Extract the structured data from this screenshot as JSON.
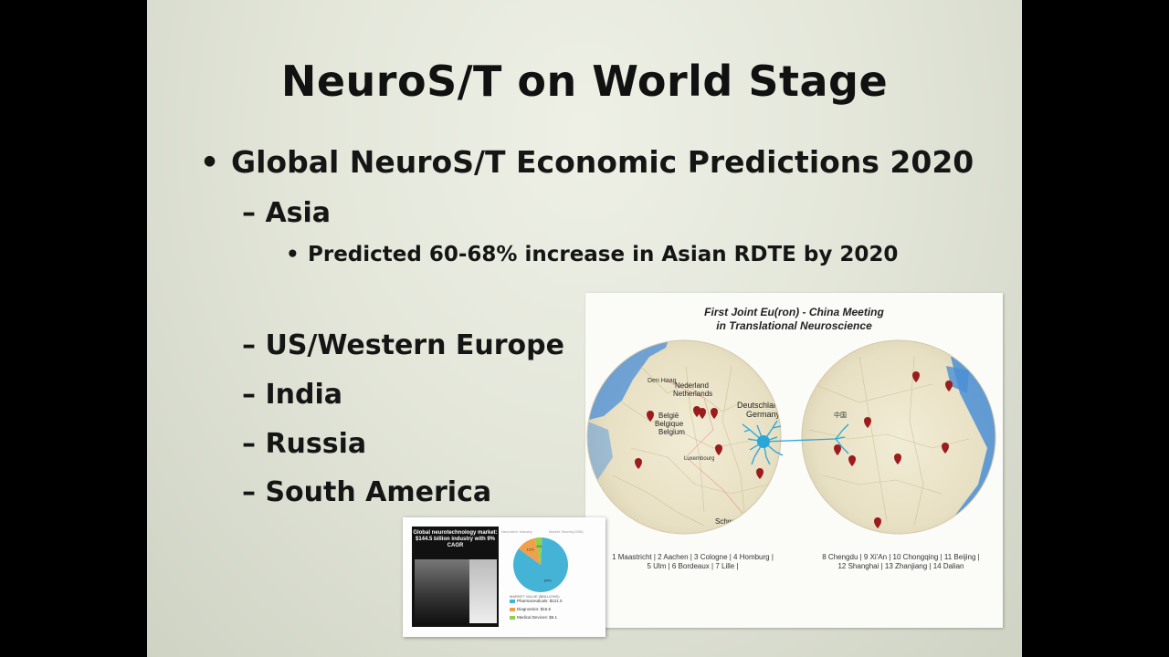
{
  "slide": {
    "title": "NeuroS/T on World Stage",
    "bullet_main": "Global NeuroS/T Economic Predictions 2020",
    "bullet_symbol": "•",
    "dash": "–",
    "regions": [
      {
        "label": "Asia"
      },
      {
        "label": "US/Western Europe"
      },
      {
        "label": "India"
      },
      {
        "label": "Russia"
      },
      {
        "label": "South America"
      }
    ],
    "asia_detail": "Predicted 60-68% increase in Asian RDTE by 2020"
  },
  "map_image": {
    "title_line1": "First Joint Eu(ron) - China Meeting",
    "title_line2": "in Translational Neuroscience",
    "map_labels": {
      "nederland": "Nederland",
      "netherlands": "Netherlands",
      "belgie": "België",
      "belgique": "Belgique",
      "belgium": "Belgium",
      "deutschland": "Deutschland",
      "germany": "Germany",
      "luxembourg": "Luxembourg",
      "schweiz": "Schweiz",
      "suisse": "Suisse",
      "svizzera": "Svizzera",
      "den_haag": "Den Haag",
      "china": "中国"
    },
    "caption_left_line1": "1 Maastricht | 2 Aachen | 3 Cologne | 4 Homburg |",
    "caption_left_line2": "5 Ulm | 6 Bordeaux | 7 Lille |",
    "caption_right_line1": "8 Chengdu | 9 Xi'An | 10 Chongqing | 11 Beijing |",
    "caption_right_line2": "12 Shanghai | 13 Zhanjiang | 14 Dalian",
    "colors": {
      "pin": "#9b1c1c",
      "neuron": "#2aa6d8",
      "ocean": "#4a8fd6",
      "land": "#ece6cf"
    }
  },
  "market_image": {
    "headline": "Global neurotechnology market: $144.5 billion industry with 9% CAGR",
    "sub_left": "Neurotech Industry",
    "sub_right": "Market Shares(2008)",
    "legend_title": "MARKET VALUE ($BILLIONS)",
    "legend": [
      {
        "label": "Pharmaceuticals: $121.0",
        "color": "#45b3d6"
      },
      {
        "label": "Diagnostics: $16.5",
        "color": "#f0a04a"
      },
      {
        "label": "Medical Devices: $6.1",
        "color": "#8fd14f"
      }
    ],
    "chart_data": {
      "type": "pie",
      "categories": [
        "Pharmaceuticals",
        "Diagnostics",
        "Medical Devices"
      ],
      "values": [
        121.0,
        16.5,
        6.1
      ],
      "slice_labels": [
        "84%",
        "12%",
        "4%"
      ]
    }
  }
}
